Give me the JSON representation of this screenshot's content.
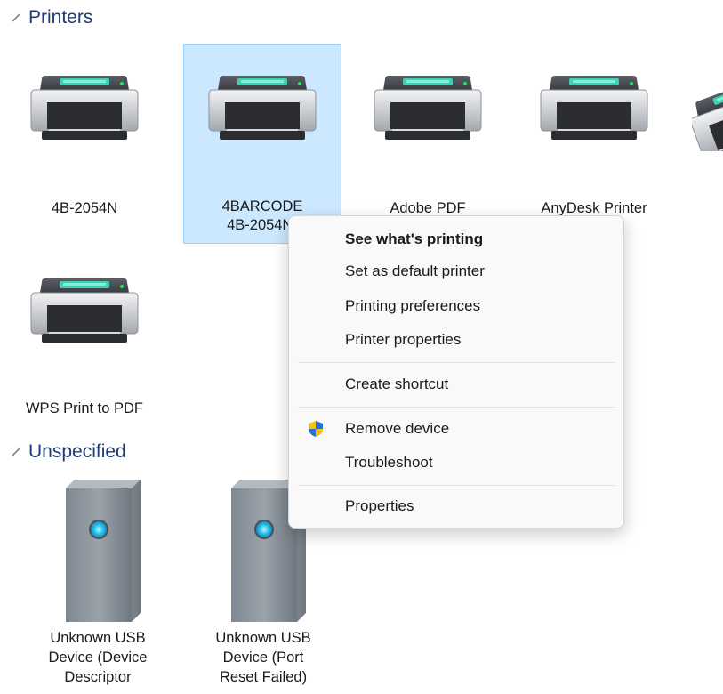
{
  "groups": {
    "printers": {
      "title": "Printers"
    },
    "unspecified": {
      "title": "Unspecified"
    }
  },
  "devices": {
    "printer_1": {
      "label": "4B-2054N",
      "icon": "printer-icon"
    },
    "printer_2": {
      "label_line1": "4BARCODE",
      "label_line2": "4B-2054N(",
      "icon": "printer-icon",
      "selected": true
    },
    "printer_3": {
      "label": "Adobe PDF",
      "icon": "printer-icon"
    },
    "printer_4": {
      "label": "AnyDesk Printer",
      "icon": "printer-icon"
    },
    "printer_5": {
      "label": "WPS Print to PDF",
      "icon": "printer-icon"
    },
    "usb_1": {
      "label_line1": "Unknown USB",
      "label_line2": "Device (Device",
      "label_line3": "Descriptor",
      "icon": "usb-device-icon"
    },
    "usb_2": {
      "label_line1": "Unknown USB",
      "label_line2": "Device (Port",
      "label_line3": "Reset Failed)",
      "icon": "usb-device-icon"
    }
  },
  "context_menu": {
    "items": [
      {
        "label": "See what's printing",
        "bold": true
      },
      {
        "label": "Set as default printer"
      },
      {
        "label": "Printing preferences"
      },
      {
        "label": "Printer properties"
      },
      {
        "label": "Create shortcut"
      },
      {
        "label": "Remove device",
        "icon": "uac-shield-icon"
      },
      {
        "label": "Troubleshoot"
      },
      {
        "label": "Properties"
      }
    ]
  },
  "colors": {
    "group_header": "#1e3c78",
    "selection_bg": "#cce8ff",
    "selection_border": "#99d1ff",
    "menu_bg": "#f9f9f9"
  }
}
